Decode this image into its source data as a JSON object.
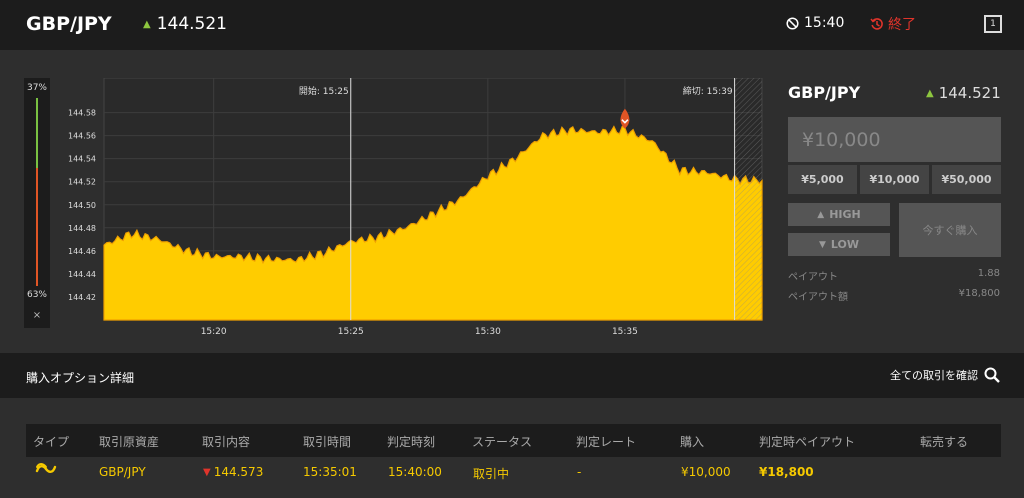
{
  "header": {
    "pair": "GBP/JPY",
    "rate": "144.521",
    "timer": "15:40",
    "end_label": "終了",
    "window_number": "1"
  },
  "gauge": {
    "high_pct": "37%",
    "low_pct": "63%",
    "close": "×"
  },
  "chart_data": {
    "type": "area",
    "start_label": "開始: 15:25",
    "end_label": "締切: 15:39",
    "y_ticks": [
      "144.58",
      "144.56",
      "144.54",
      "144.52",
      "144.50",
      "144.48",
      "144.46",
      "144.44",
      "144.42"
    ],
    "x_ticks": [
      "15:20",
      "15:25",
      "15:30",
      "15:35"
    ],
    "ylim": [
      144.4,
      144.61
    ],
    "x": [
      "15:16",
      "15:17",
      "15:18",
      "15:19",
      "15:20",
      "15:21",
      "15:22",
      "15:23",
      "15:24",
      "15:25",
      "15:26",
      "15:27",
      "15:28",
      "15:29",
      "15:30",
      "15:31",
      "15:32",
      "15:33",
      "15:34",
      "15:35",
      "15:36",
      "15:37",
      "15:38",
      "15:39",
      "15:40"
    ],
    "values": [
      144.465,
      144.475,
      144.47,
      144.46,
      144.455,
      144.455,
      144.453,
      144.452,
      144.458,
      144.468,
      144.472,
      144.48,
      144.492,
      144.505,
      144.525,
      144.54,
      144.56,
      144.565,
      144.563,
      144.565,
      144.555,
      144.53,
      144.528,
      144.522,
      144.521
    ],
    "purchase_marker": {
      "time": "15:35",
      "value": 144.573
    },
    "colors": {
      "fill": "#ffcc00",
      "line": "#f0a000",
      "background": "#2a2a2a"
    }
  },
  "panel": {
    "pair": "GBP/JPY",
    "rate": "144.521",
    "amount": "¥10,000",
    "amounts": [
      "¥5,000",
      "¥10,000",
      "¥50,000"
    ],
    "high_label": "HIGH",
    "low_label": "LOW",
    "buy_now": "今すぐ購入",
    "payout_label": "ペイアウト",
    "payout_value": "1.88",
    "payout_amount_label": "ペイアウト額",
    "payout_amount_value": "¥18,800"
  },
  "section": {
    "title": "購入オプション詳細",
    "all_trades": "全ての取引を確認"
  },
  "table": {
    "headers": [
      "タイプ",
      "取引原資産",
      "取引内容",
      "取引時間",
      "判定時刻",
      "ステータス",
      "判定レート",
      "購入",
      "判定時ペイアウト",
      "転売する"
    ],
    "row": {
      "asset": "GBP/JPY",
      "content": "144.573",
      "trade_time": "15:35:01",
      "judge_time": "15:40:00",
      "status": "取引中",
      "judge_rate": "-",
      "purchase": "¥10,000",
      "payout": "¥18,800"
    }
  }
}
